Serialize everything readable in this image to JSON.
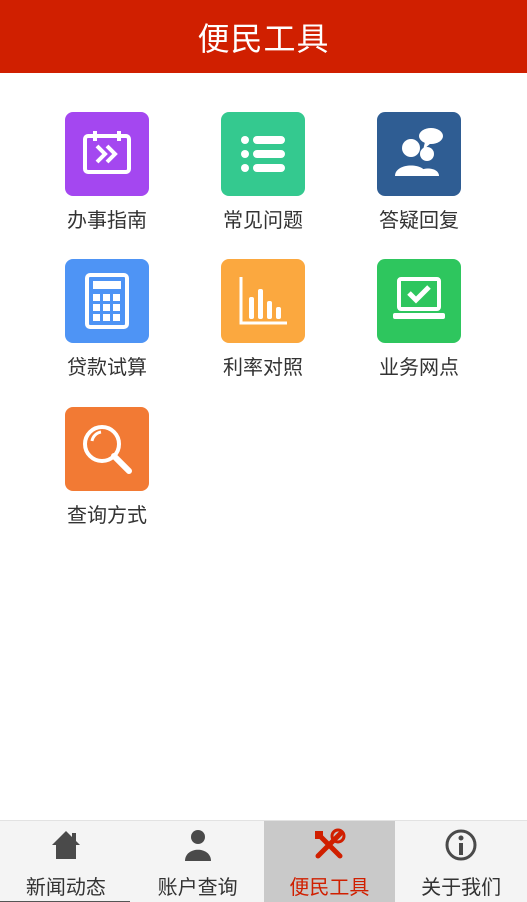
{
  "header": {
    "title": "便民工具"
  },
  "tools": [
    {
      "label": "办事指南",
      "icon": "calendar-forward-icon",
      "color": "#a447f0"
    },
    {
      "label": "常见问题",
      "icon": "list-icon",
      "color": "#34c98f"
    },
    {
      "label": "答疑回复",
      "icon": "consultation-icon",
      "color": "#2f5d93"
    },
    {
      "label": "贷款试算",
      "icon": "calculator-icon",
      "color": "#4e94f5"
    },
    {
      "label": "利率对照",
      "icon": "bar-chart-icon",
      "color": "#fba83f"
    },
    {
      "label": "业务网点",
      "icon": "laptop-check-icon",
      "color": "#2ec65e"
    },
    {
      "label": "查询方式",
      "icon": "search-icon",
      "color": "#f27a34"
    }
  ],
  "tabbar": {
    "active_color": "#d01f00",
    "items": [
      {
        "label": "新闻动态",
        "icon": "home-icon"
      },
      {
        "label": "账户查询",
        "icon": "user-icon"
      },
      {
        "label": "便民工具",
        "icon": "tools-icon",
        "active": true
      },
      {
        "label": "关于我们",
        "icon": "info-icon"
      }
    ]
  }
}
